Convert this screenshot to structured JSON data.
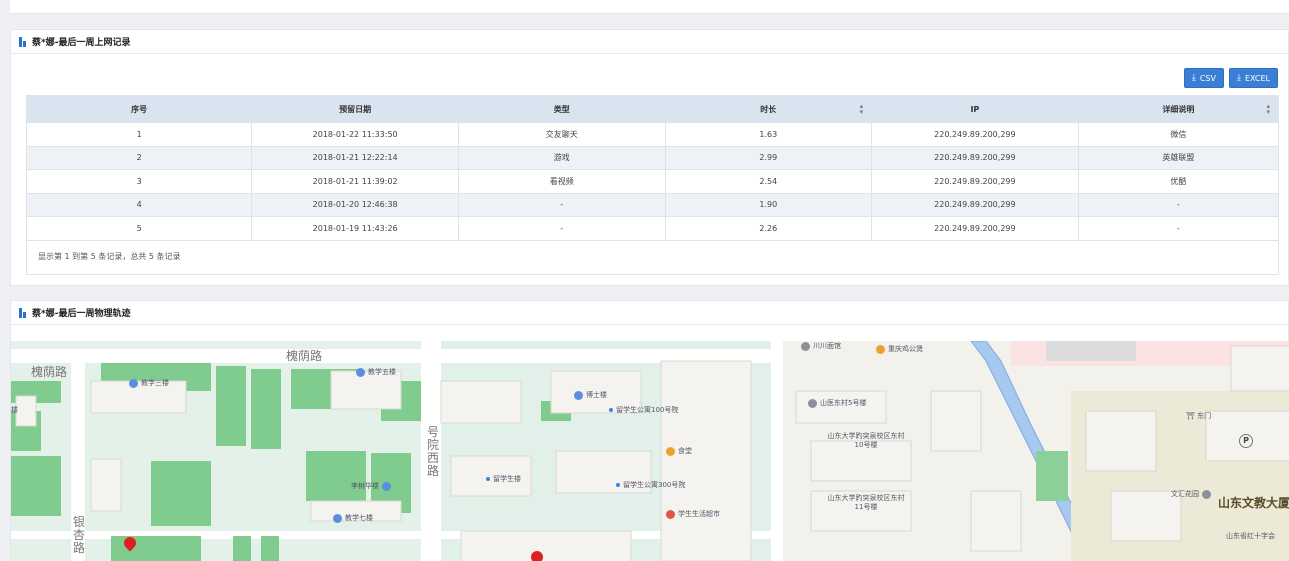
{
  "panel1": {
    "title": "蔡*娜-最后一周上网记录",
    "buttons": {
      "csv": "CSV",
      "excel": "EXCEL"
    },
    "columns": [
      "序号",
      "预留日期",
      "类型",
      "时长",
      "IP",
      "详细说明"
    ],
    "rows": [
      [
        "1",
        "2018-01-22 11:33:50",
        "交友聊天",
        "1.63",
        "220.249.89.200,299",
        "微信"
      ],
      [
        "2",
        "2018-01-21 12:22:14",
        "游戏",
        "2.99",
        "220.249.89.200,299",
        "英雄联盟"
      ],
      [
        "3",
        "2018-01-21 11:39:02",
        "看视频",
        "2.54",
        "220.249.89.200,299",
        "优酷"
      ],
      [
        "4",
        "2018-01-20 12:46:38",
        "-",
        "1.90",
        "220.249.89.200,299",
        "-"
      ],
      [
        "5",
        "2018-01-19 11:43:26",
        "-",
        "2.26",
        "220.249.89.200,299",
        "-"
      ]
    ],
    "summary": "显示第 1 到第 5 条记录，总共 5 条记录"
  },
  "panel2": {
    "title": "蔡*娜-最后一周物理轨迹",
    "map_labels": {
      "road1": "槐荫路",
      "road2": "槐荫路",
      "road3": "号院西路",
      "road4": "银杏路",
      "b3": "教学三楼",
      "b5": "教学五楼",
      "b7": "教学七楼",
      "dr": "博士楼",
      "lx": "留学生楼",
      "lx100": "留学生公寓100号院",
      "lx300": "留学生公寓300号院",
      "st": "食堂",
      "xssh": "学生生活超市",
      "lib": "李树华楼",
      "cc": "川川面馆",
      "cq": "重庆鸡公煲",
      "sy5": "山医东村5号楼",
      "sd10": "山东大学趵突泉校区东村10号楼",
      "sd11": "山东大学趵突泉校区东村11号楼",
      "dm": "东门",
      "wh": "文汇花园",
      "sdwj": "山东文教大厦",
      "hsz": "山东省红十字会",
      "building": "楼"
    }
  }
}
